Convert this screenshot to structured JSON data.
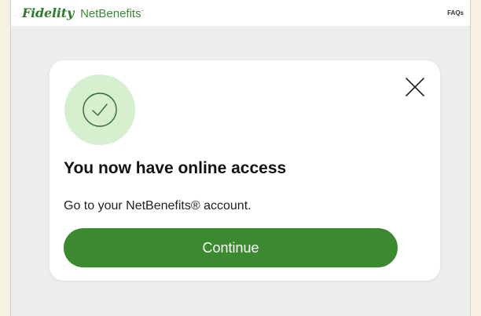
{
  "header": {
    "brand_primary": "Fidelity",
    "brand_secondary": "NetBenefits",
    "brand_mark": "·",
    "faqs_label": "FAQs"
  },
  "modal": {
    "icon": "check-circle-icon",
    "close_icon": "close-icon",
    "title": "You now have online access",
    "description": "Go to your NetBenefits® account.",
    "button_label": "Continue"
  },
  "colors": {
    "page_background": "#ededed",
    "brand_green": "#2f7d2a",
    "success_circle_bg": "#d6f0cf",
    "button_green": "#3b8a2f"
  }
}
